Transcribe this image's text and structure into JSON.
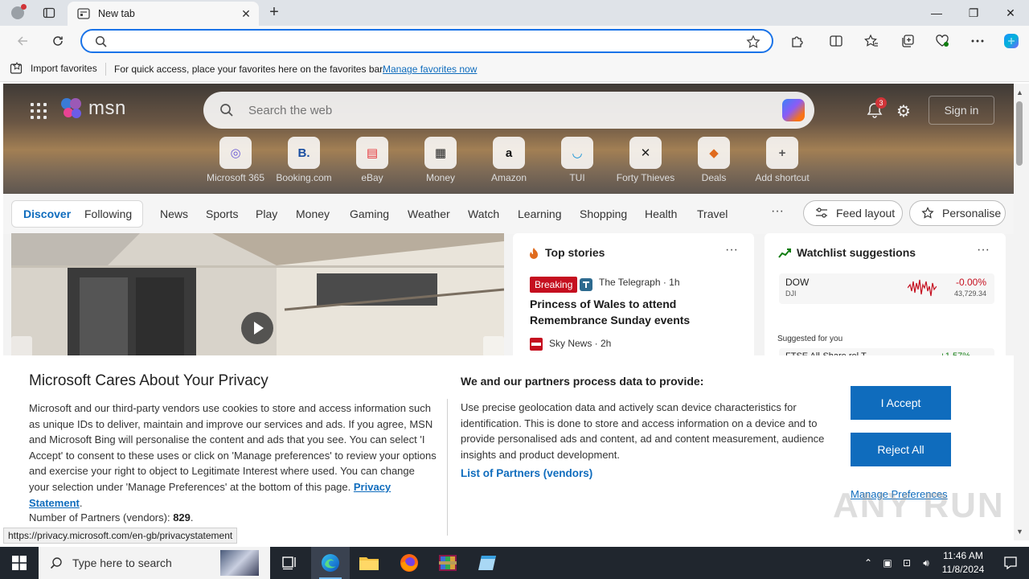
{
  "browser": {
    "tab_title": "New tab",
    "tab_close": "✕",
    "new_tab": "+",
    "window_controls": {
      "minimize": "—",
      "restore": "❐",
      "close": "✕"
    },
    "address_value": "",
    "favorites": {
      "import_label": "Import favorites",
      "hint": "For quick access, place your favorites here on the favorites bar.",
      "manage_link": "Manage favorites now"
    }
  },
  "msn": {
    "logo_text": "msn",
    "search_placeholder": "Search the web",
    "notification_count": "3",
    "signin_label": "Sign in",
    "shortcuts": [
      {
        "label": "Microsoft 365",
        "glyph": "◎",
        "color": "#6b5bd6"
      },
      {
        "label": "Booking.com",
        "glyph": "B.",
        "color": "#1a4ea1"
      },
      {
        "label": "eBay",
        "glyph": "▤",
        "color": "#e53238"
      },
      {
        "label": "Money",
        "glyph": "▦",
        "color": "#222222"
      },
      {
        "label": "Amazon",
        "glyph": "a",
        "color": "#111111"
      },
      {
        "label": "TUI",
        "glyph": "◡",
        "color": "#0a8fd6"
      },
      {
        "label": "Forty Thieves",
        "glyph": "✕",
        "color": "#222222"
      },
      {
        "label": "Deals",
        "glyph": "◆",
        "color": "#e06b1e"
      },
      {
        "label": "Add shortcut",
        "glyph": "+",
        "color": "#555555"
      }
    ],
    "feed_tabs": {
      "discover": "Discover",
      "following": "Following"
    },
    "nav_items": [
      "News",
      "Sports",
      "Play",
      "Money",
      "Gaming",
      "Weather",
      "Watch",
      "Learning",
      "Shopping",
      "Health",
      "Travel"
    ],
    "nav_more": "···",
    "feed_layout_label": "Feed layout",
    "personalise_label": "Personalise",
    "top_stories": {
      "title": "Top stories",
      "more": "···",
      "badge": "Breaking",
      "source": "The Telegraph · 1h",
      "headline": "Princess of Wales to attend Remembrance Sunday events",
      "source2": "Sky News · 2h"
    },
    "watchlist": {
      "title": "Watchlist suggestions",
      "more": "···",
      "dow_name": "DOW",
      "dow_sub": "DJI",
      "dow_change": "-0.00%",
      "dow_price": "43,729.34",
      "suggested_label": "Suggested for you",
      "ftse_name": "FTSE All-Share rel T...",
      "ftse_change": "+1.57%"
    }
  },
  "privacy": {
    "title": "Microsoft Cares About Your Privacy",
    "body": "Microsoft and our third-party vendors use cookies to store and access information such as unique IDs to deliver, maintain and improve our services and ads. If you agree, MSN and Microsoft Bing will personalise the content and ads that you see. You can select 'I Accept' to consent to these uses or click on 'Manage preferences' to review your options and exercise your right to object to Legitimate Interest where used.  You can change your selection under 'Manage Preferences' at the bottom of this page.",
    "privacy_link": "Privacy Statement",
    "partners_label": "Number of Partners (vendors):",
    "partners_count": "829",
    "process_title": "We and our partners process data to provide:",
    "process_body": "Use precise geolocation data and actively scan device characteristics for identification. This is done to store and access information on a device and to provide personalised ads and content, ad and content measurement, audience insights and product development.",
    "vendors_link": "List of Partners (vendors)",
    "accept_label": "I Accept",
    "reject_label": "Reject All",
    "manage_label": "Manage Preferences"
  },
  "status_url": "https://privacy.microsoft.com/en-gb/privacystatement",
  "watermark": "ANY RUN",
  "taskbar": {
    "search_placeholder": "Type here to search",
    "time": "11:46 AM",
    "date": "11/8/2024"
  },
  "colors": {
    "accent": "#0f6cbd",
    "taskbar": "#20262e",
    "breaking": "#c50f1f"
  }
}
